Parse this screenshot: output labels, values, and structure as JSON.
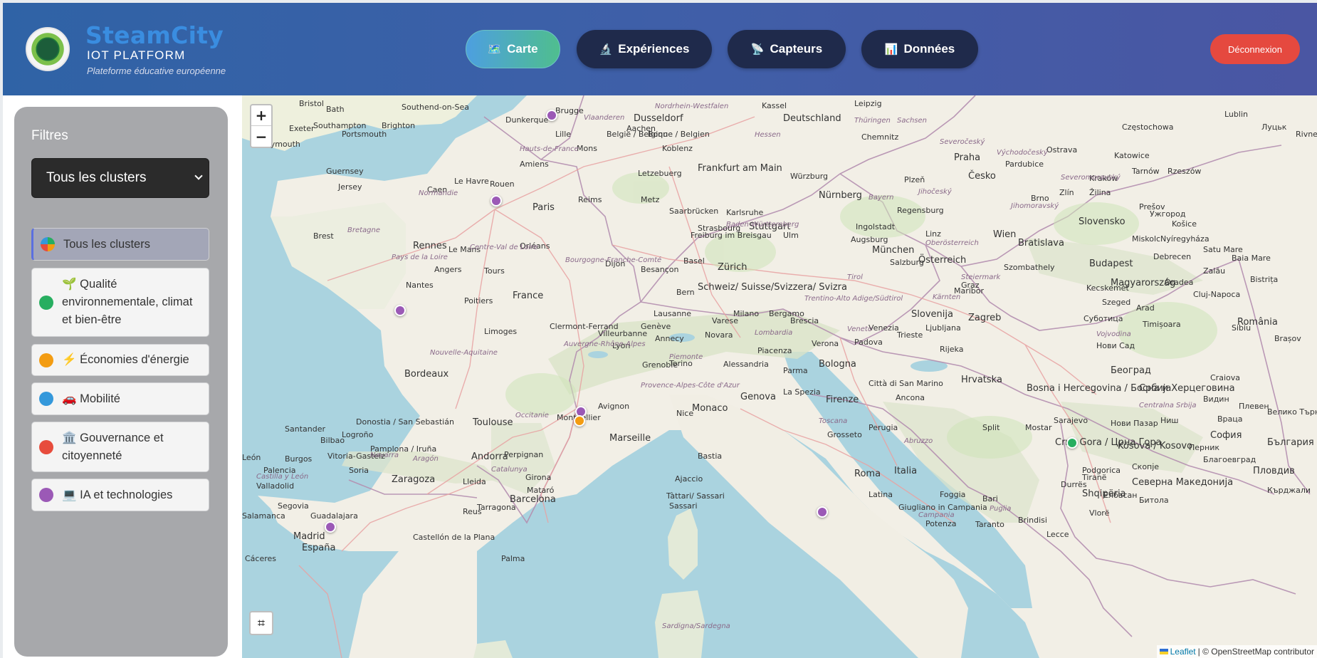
{
  "header": {
    "title": "SteamCity",
    "subtitle": "IOT PLATFORM",
    "tagline": "Plateforme éducative européenne",
    "nav": [
      {
        "label": "Carte",
        "icon": "🗺️"
      },
      {
        "label": "Expériences",
        "icon": "🔬"
      },
      {
        "label": "Capteurs",
        "icon": "📡"
      },
      {
        "label": "Données",
        "icon": "📊"
      }
    ],
    "logout": "Déconnexion"
  },
  "sidebar": {
    "title": "Filtres",
    "select_value": "Tous les clusters",
    "clusters": [
      {
        "label": "Tous les clusters",
        "color": "multi"
      },
      {
        "label": "🌱 Qualité environnementale, climat et bien-être",
        "color": "#27ae60"
      },
      {
        "label": "⚡ Économies d'énergie",
        "color": "#f39c12"
      },
      {
        "label": "🚗 Mobilité",
        "color": "#3498db"
      },
      {
        "label": "🏛️ Gouvernance et citoyenneté",
        "color": "#e74c3c"
      },
      {
        "label": "💻 IA et technologies",
        "color": "#9b59b6"
      }
    ]
  },
  "map": {
    "zoom_in": "+",
    "zoom_out": "−",
    "grid_icon": "⌗",
    "attribution_link": "Leaflet",
    "attribution_text": "| © OpenStreetMap contributor",
    "labels": [
      {
        "text": "Dusseldorf",
        "big": true
      },
      {
        "text": "Deutschland",
        "big": true
      },
      {
        "text": "Leipzig"
      },
      {
        "text": "Kassel"
      },
      {
        "text": "Chemnitz"
      },
      {
        "text": "Praha",
        "big": true
      },
      {
        "text": "Česko",
        "big": true
      },
      {
        "text": "Katowice"
      },
      {
        "text": "Częstochowa"
      },
      {
        "text": "Ostrava"
      },
      {
        "text": "Brugge"
      },
      {
        "text": "Lille"
      },
      {
        "text": "Mons"
      },
      {
        "text": "Aachen"
      },
      {
        "text": "Bonn"
      },
      {
        "text": "Koblenz"
      },
      {
        "text": "België / Belgique / Belgien"
      },
      {
        "text": "Frankfurt am Main",
        "big": true
      },
      {
        "text": "Würzburg"
      },
      {
        "text": "Nürnberg",
        "big": true
      },
      {
        "text": "Letzebuerg"
      },
      {
        "text": "Saarbrücken"
      },
      {
        "text": "Karlsruhe"
      },
      {
        "text": "Stuttgart",
        "big": true
      },
      {
        "text": "Ingolstadt"
      },
      {
        "text": "Augsburg"
      },
      {
        "text": "München",
        "big": true
      },
      {
        "text": "Regensburg"
      },
      {
        "text": "Plzeň"
      },
      {
        "text": "Pardubice"
      },
      {
        "text": "Brno"
      },
      {
        "text": "Zlín"
      },
      {
        "text": "Žilina"
      },
      {
        "text": "Wien",
        "big": true
      },
      {
        "text": "Bratislava",
        "big": true
      },
      {
        "text": "Slovensko",
        "big": true
      },
      {
        "text": "Košice"
      },
      {
        "text": "Budapest",
        "big": true
      },
      {
        "text": "Magyarország",
        "big": true
      },
      {
        "text": "Österreich",
        "big": true
      },
      {
        "text": "Salzburg"
      },
      {
        "text": "Graz"
      },
      {
        "text": "Linz"
      },
      {
        "text": "Paris",
        "big": true
      },
      {
        "text": "Rouen"
      },
      {
        "text": "Le Havre"
      },
      {
        "text": "Caen"
      },
      {
        "text": "Amiens"
      },
      {
        "text": "Reims"
      },
      {
        "text": "Metz"
      },
      {
        "text": "Strasbourg"
      },
      {
        "text": "Dunkerque"
      },
      {
        "text": "Rennes",
        "big": true
      },
      {
        "text": "Brest"
      },
      {
        "text": "Angers"
      },
      {
        "text": "Nantes"
      },
      {
        "text": "Tours"
      },
      {
        "text": "Orléans"
      },
      {
        "text": "Le Mans"
      },
      {
        "text": "Dijon"
      },
      {
        "text": "Besançon"
      },
      {
        "text": "Basel"
      },
      {
        "text": "Zürich",
        "big": true
      },
      {
        "text": "Freiburg im Breisgau"
      },
      {
        "text": "Ulm"
      },
      {
        "text": "Bern"
      },
      {
        "text": "Schweiz/ Suisse/Svizzera/ Svizra",
        "big": true
      },
      {
        "text": "Lausanne"
      },
      {
        "text": "Genève"
      },
      {
        "text": "Poitiers"
      },
      {
        "text": "France",
        "big": true
      },
      {
        "text": "Limoges"
      },
      {
        "text": "Clermont-Ferrand"
      },
      {
        "text": "Villeurbanne"
      },
      {
        "text": "Lyon"
      },
      {
        "text": "Annecy"
      },
      {
        "text": "Grenoble"
      },
      {
        "text": "Bordeaux",
        "big": true
      },
      {
        "text": "Toulouse",
        "big": true
      },
      {
        "text": "Montpellier"
      },
      {
        "text": "Avignon"
      },
      {
        "text": "Marseille",
        "big": true
      },
      {
        "text": "Monaco",
        "big": true
      },
      {
        "text": "Nice"
      },
      {
        "text": "Genova",
        "big": true
      },
      {
        "text": "Milano"
      },
      {
        "text": "Torino"
      },
      {
        "text": "Novara"
      },
      {
        "text": "Varese"
      },
      {
        "text": "Bergamo"
      },
      {
        "text": "Brescia"
      },
      {
        "text": "Verona"
      },
      {
        "text": "Padova"
      },
      {
        "text": "Venezia"
      },
      {
        "text": "Trieste"
      },
      {
        "text": "Piacenza"
      },
      {
        "text": "Parma"
      },
      {
        "text": "Bologna",
        "big": true
      },
      {
        "text": "Alessandria"
      },
      {
        "text": "La Spezia"
      },
      {
        "text": "Firenze",
        "big": true
      },
      {
        "text": "Città di San Marino"
      },
      {
        "text": "Ancona"
      },
      {
        "text": "Perugia"
      },
      {
        "text": "Grosseto"
      },
      {
        "text": "Roma",
        "big": true
      },
      {
        "text": "Italia",
        "big": true
      },
      {
        "text": "Latina"
      },
      {
        "text": "Giugliano in Campania"
      },
      {
        "text": "Foggia"
      },
      {
        "text": "Bari"
      },
      {
        "text": "Potenza"
      },
      {
        "text": "Taranto"
      },
      {
        "text": "Brindisi"
      },
      {
        "text": "Lecce"
      },
      {
        "text": "Ajaccio"
      },
      {
        "text": "Bastia"
      },
      {
        "text": "Sassari"
      },
      {
        "text": "Tàttari/ Sassari"
      },
      {
        "text": "Slovenija",
        "big": true
      },
      {
        "text": "Ljubljana"
      },
      {
        "text": "Zagreb",
        "big": true
      },
      {
        "text": "Rijeka"
      },
      {
        "text": "Hrvatska",
        "big": true
      },
      {
        "text": "Bosna i Hercegovina / Босна и Херцеговина",
        "big": true
      },
      {
        "text": "Sarajevo"
      },
      {
        "text": "Mostar"
      },
      {
        "text": "Split"
      },
      {
        "text": "Podgorica"
      },
      {
        "text": "Crna Gora / Црна Гора",
        "big": true
      },
      {
        "text": "Kosova / Kosovo",
        "big": true
      },
      {
        "text": "Београд",
        "big": true
      },
      {
        "text": "Србија",
        "big": true
      },
      {
        "text": "Ниш"
      },
      {
        "text": "Нови Пазар"
      },
      {
        "text": "Скопје"
      },
      {
        "text": "Северна Македонија",
        "big": true
      },
      {
        "text": "Битола"
      },
      {
        "text": "Shqipëria",
        "big": true
      },
      {
        "text": "Tiranë"
      },
      {
        "text": "Vlorë"
      },
      {
        "text": "Durrës"
      },
      {
        "text": "Елбасан"
      },
      {
        "text": "România",
        "big": true
      },
      {
        "text": "Cluj-Napoca"
      },
      {
        "text": "Timișoara"
      },
      {
        "text": "Oradea"
      },
      {
        "text": "Arad"
      },
      {
        "text": "Szeged"
      },
      {
        "text": "Kecskemét"
      },
      {
        "text": "Debrecen"
      },
      {
        "text": "Miskolc"
      },
      {
        "text": "Szombathely"
      },
      {
        "text": "Maribor"
      },
      {
        "text": "Суботица"
      },
      {
        "text": "Нови Сад"
      },
      {
        "text": "Brașov"
      },
      {
        "text": "Craiova"
      },
      {
        "text": "Sibiu"
      },
      {
        "text": "Видин"
      },
      {
        "text": "Враца"
      },
      {
        "text": "София",
        "big": true
      },
      {
        "text": "Перник"
      },
      {
        "text": "Благоевград"
      },
      {
        "text": "Пловдив",
        "big": true
      },
      {
        "text": "България",
        "big": true
      },
      {
        "text": "Кърджали"
      },
      {
        "text": "Плевен"
      },
      {
        "text": "Велико Търново"
      },
      {
        "text": "Ужгород"
      },
      {
        "text": "Луцьк"
      },
      {
        "text": "Rivne"
      },
      {
        "text": "Zalău"
      },
      {
        "text": "Bistrița"
      },
      {
        "text": "Baia Mare"
      },
      {
        "text": "Satu Mare"
      },
      {
        "text": "Nyíregyháza"
      },
      {
        "text": "Prešov"
      },
      {
        "text": "Rzeszów"
      },
      {
        "text": "Kraków"
      },
      {
        "text": "Lublin"
      },
      {
        "text": "Tarnów"
      },
      {
        "text": "Bath"
      },
      {
        "text": "Bristol"
      },
      {
        "text": "Southampton"
      },
      {
        "text": "Brighton"
      },
      {
        "text": "Portsmouth"
      },
      {
        "text": "Exeter"
      },
      {
        "text": "Plymouth"
      },
      {
        "text": "Southend-on-Sea"
      },
      {
        "text": "Guernsey"
      },
      {
        "text": "Jersey"
      },
      {
        "text": "Santander"
      },
      {
        "text": "Bilbao"
      },
      {
        "text": "Donostia / San Sebastián"
      },
      {
        "text": "Vitoria-Gasteiz"
      },
      {
        "text": "Pamplona / Iruña"
      },
      {
        "text": "Andorra",
        "big": true
      },
      {
        "text": "Perpignan"
      },
      {
        "text": "Girona"
      },
      {
        "text": "Barcelona",
        "big": true
      },
      {
        "text": "Lleida"
      },
      {
        "text": "Tarragona"
      },
      {
        "text": "Zaragoza",
        "big": true
      },
      {
        "text": "Burgos"
      },
      {
        "text": "León"
      },
      {
        "text": "Palencia"
      },
      {
        "text": "Valladolid"
      },
      {
        "text": "Salamanca"
      },
      {
        "text": "Segovia"
      },
      {
        "text": "Guadalajara"
      },
      {
        "text": "Madrid",
        "big": true
      },
      {
        "text": "España",
        "big": true
      },
      {
        "text": "Cáceres"
      },
      {
        "text": "Castellón de la Plana"
      },
      {
        "text": "Palma"
      },
      {
        "text": "Reus"
      },
      {
        "text": "Mataró"
      },
      {
        "text": "Soria"
      },
      {
        "text": "Logroño"
      },
      {
        "text": "Normandie",
        "region": true
      },
      {
        "text": "Bretagne",
        "region": true
      },
      {
        "text": "Pays de la Loire",
        "region": true
      },
      {
        "text": "Centre-Val de Loire",
        "region": true
      },
      {
        "text": "Hauts-de-France",
        "region": true
      },
      {
        "text": "Bourgogne-Franche-Comté",
        "region": true
      },
      {
        "text": "Nouvelle-Aquitaine",
        "region": true
      },
      {
        "text": "Auvergne-Rhône-Alpes",
        "region": true
      },
      {
        "text": "Occitanie",
        "region": true
      },
      {
        "text": "Provence-Alpes-Côte d'Azur",
        "region": true
      },
      {
        "text": "Vlaanderen",
        "region": true
      },
      {
        "text": "Hessen",
        "region": true
      },
      {
        "text": "Thüringen",
        "region": true
      },
      {
        "text": "Sachsen",
        "region": true
      },
      {
        "text": "Bayern",
        "region": true
      },
      {
        "text": "Baden-Württemberg",
        "region": true
      },
      {
        "text": "Oberösterreich",
        "region": true
      },
      {
        "text": "Steiermark",
        "region": true
      },
      {
        "text": "Kärnten",
        "region": true
      },
      {
        "text": "Tirol",
        "region": true
      },
      {
        "text": "Lombardia",
        "region": true
      },
      {
        "text": "Piemonte",
        "region": true
      },
      {
        "text": "Veneto",
        "region": true
      },
      {
        "text": "Toscana",
        "region": true
      },
      {
        "text": "Abruzzo",
        "region": true
      },
      {
        "text": "Campania",
        "region": true
      },
      {
        "text": "Puglia",
        "region": true
      },
      {
        "text": "Castilla y León",
        "region": true
      },
      {
        "text": "Navarra",
        "region": true
      },
      {
        "text": "Nordrhein-Westfalen",
        "region": true
      },
      {
        "text": "Jihočeský",
        "region": true
      },
      {
        "text": "Severočeský",
        "region": true
      },
      {
        "text": "Východočeský",
        "region": true
      },
      {
        "text": "Jihomoravský",
        "region": true
      },
      {
        "text": "Severomoravský",
        "region": true
      },
      {
        "text": "Trentino-Alto Adige/Südtirol",
        "region": true
      },
      {
        "text": "Sardigna/Sardegna",
        "region": true
      },
      {
        "text": "Aragón",
        "region": true
      },
      {
        "text": "Catalunya",
        "region": true
      },
      {
        "text": "Vojvodina",
        "region": true
      },
      {
        "text": "Centralna Srbija",
        "region": true
      }
    ],
    "markers": [
      {
        "name": "Belgique",
        "color": "#9b59b6"
      },
      {
        "name": "Paris",
        "color": "#9b59b6"
      },
      {
        "name": "La Rochelle",
        "color": "#9b59b6"
      },
      {
        "name": "Marseille-IA",
        "color": "#9b59b6"
      },
      {
        "name": "Marseille-Energie",
        "color": "#f39c12"
      },
      {
        "name": "Madrid",
        "color": "#9b59b6"
      },
      {
        "name": "Napoli",
        "color": "#9b59b6"
      },
      {
        "name": "Sofia",
        "color": "#27ae60"
      }
    ]
  }
}
